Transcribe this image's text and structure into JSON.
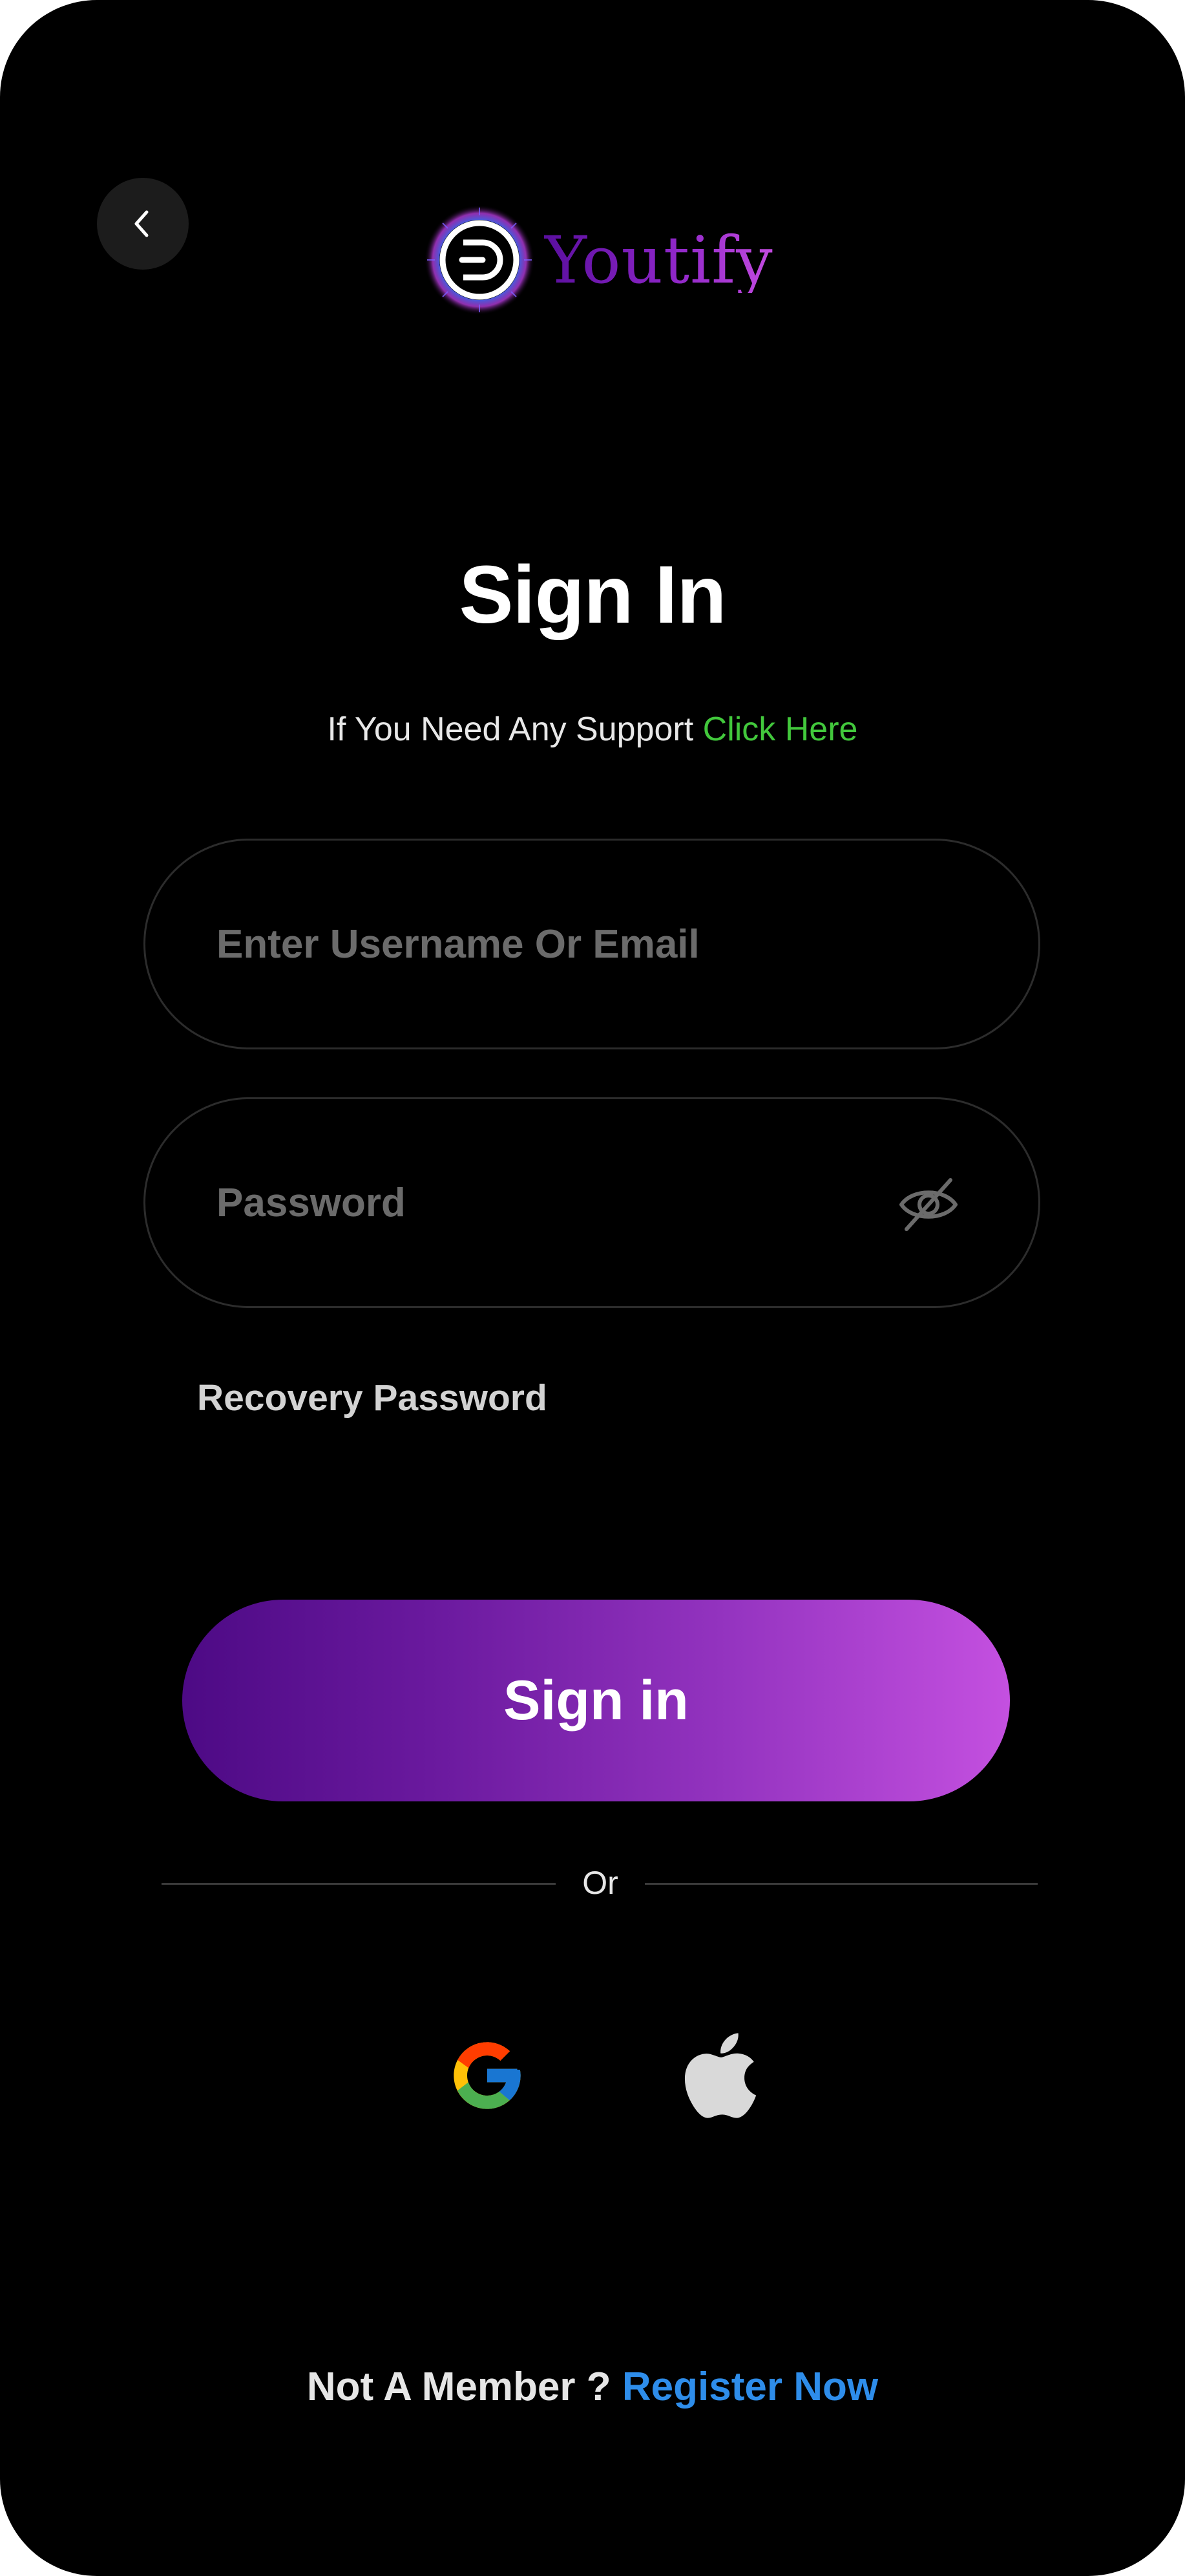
{
  "app": {
    "name": "Youtify"
  },
  "header": {
    "back_icon": "chevron-left-icon"
  },
  "page": {
    "title": "Sign In",
    "support_text": "If You Need Any Support",
    "support_link": "Click Here"
  },
  "form": {
    "username_placeholder": "Enter Username Or Email",
    "password_placeholder": "Password",
    "password_toggle_icon": "eye-off-icon",
    "recovery_label": "Recovery Password",
    "submit_label": "Sign in"
  },
  "divider": {
    "label": "Or"
  },
  "social": [
    {
      "icon": "google-icon"
    },
    {
      "icon": "apple-icon"
    }
  ],
  "footer": {
    "prompt": "Not A Member ?",
    "register_label": "Register Now"
  },
  "colors": {
    "background": "#000000",
    "accent_green": "#42c83c",
    "accent_blue": "#2e8dea",
    "button_gradient_start": "#4d0a85",
    "button_gradient_end": "#c450e0",
    "brand_purple": "#8a24c9"
  }
}
